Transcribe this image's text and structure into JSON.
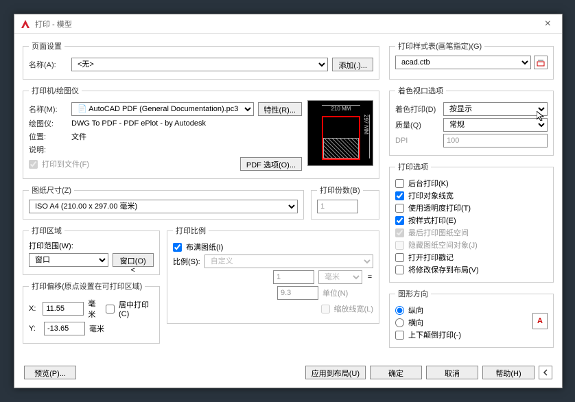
{
  "dialog": {
    "title": "打印 - 模型"
  },
  "page_setup": {
    "legend": "页面设置",
    "name_label": "名称(A):",
    "name_value": "<无>",
    "add_btn": "添加(.)..."
  },
  "plot_style": {
    "legend": "打印样式表(画笔指定)(G)",
    "value": "acad.ctb"
  },
  "printer": {
    "legend": "打印机/绘图仪",
    "name_label": "名称(M):",
    "name_value": "AutoCAD PDF (General Documentation).pc3",
    "props_btn": "特性(R)...",
    "plotter_label": "绘图仪:",
    "plotter_value": "DWG To PDF - PDF ePlot - by Autodesk",
    "location_label": "位置:",
    "location_value": "文件",
    "desc_label": "说明:",
    "to_file": "打印到文件(F)",
    "pdf_opts": "PDF 选项(O)...",
    "preview_w": "210 MM",
    "preview_h": "297 MM"
  },
  "shaded": {
    "legend": "着色视口选项",
    "shade_label": "着色打印(D)",
    "shade_value": "按显示",
    "quality_label": "质量(Q)",
    "quality_value": "常规",
    "dpi_label": "DPI",
    "dpi_value": "100"
  },
  "options": {
    "legend": "打印选项",
    "background": "后台打印(K)",
    "lineweights": "打印对象线宽",
    "transparency": "使用透明度打印(T)",
    "by_style": "按样式打印(E)",
    "paperspace_last": "最后打印图纸空间",
    "hide_ps": "隐藏图纸空间对象(J)",
    "plot_stamp": "打开打印戳记",
    "save_layout": "将修改保存到布局(V)"
  },
  "paper": {
    "legend": "图纸尺寸(Z)",
    "value": "ISO A4 (210.00 x 297.00 毫米)"
  },
  "copies": {
    "legend": "打印份数(B)",
    "value": "1"
  },
  "area": {
    "legend": "打印区域",
    "what_label": "打印范围(W):",
    "what_value": "窗口",
    "window_btn": "窗口(O)<"
  },
  "scale": {
    "legend": "打印比例",
    "fit": "布满图纸(I)",
    "scale_label": "比例(S):",
    "scale_value": "自定义",
    "num": "1",
    "unit_top": "毫米",
    "den": "9.3",
    "unit_bottom": "单位(N)",
    "scale_lw": "缩放线宽(L)"
  },
  "offset": {
    "legend": "打印偏移(原点设置在可打印区域)",
    "x_label": "X:",
    "x_value": "11.55",
    "y_label": "Y:",
    "y_value": "-13.65",
    "unit": "毫米",
    "center": "居中打印(C)"
  },
  "orient": {
    "legend": "图形方向",
    "portrait": "纵向",
    "landscape": "横向",
    "upside": "上下颠倒打印(-)"
  },
  "buttons": {
    "preview": "预览(P)...",
    "apply": "应用到布局(U)",
    "ok": "确定",
    "cancel": "取消",
    "help": "帮助(H)"
  }
}
